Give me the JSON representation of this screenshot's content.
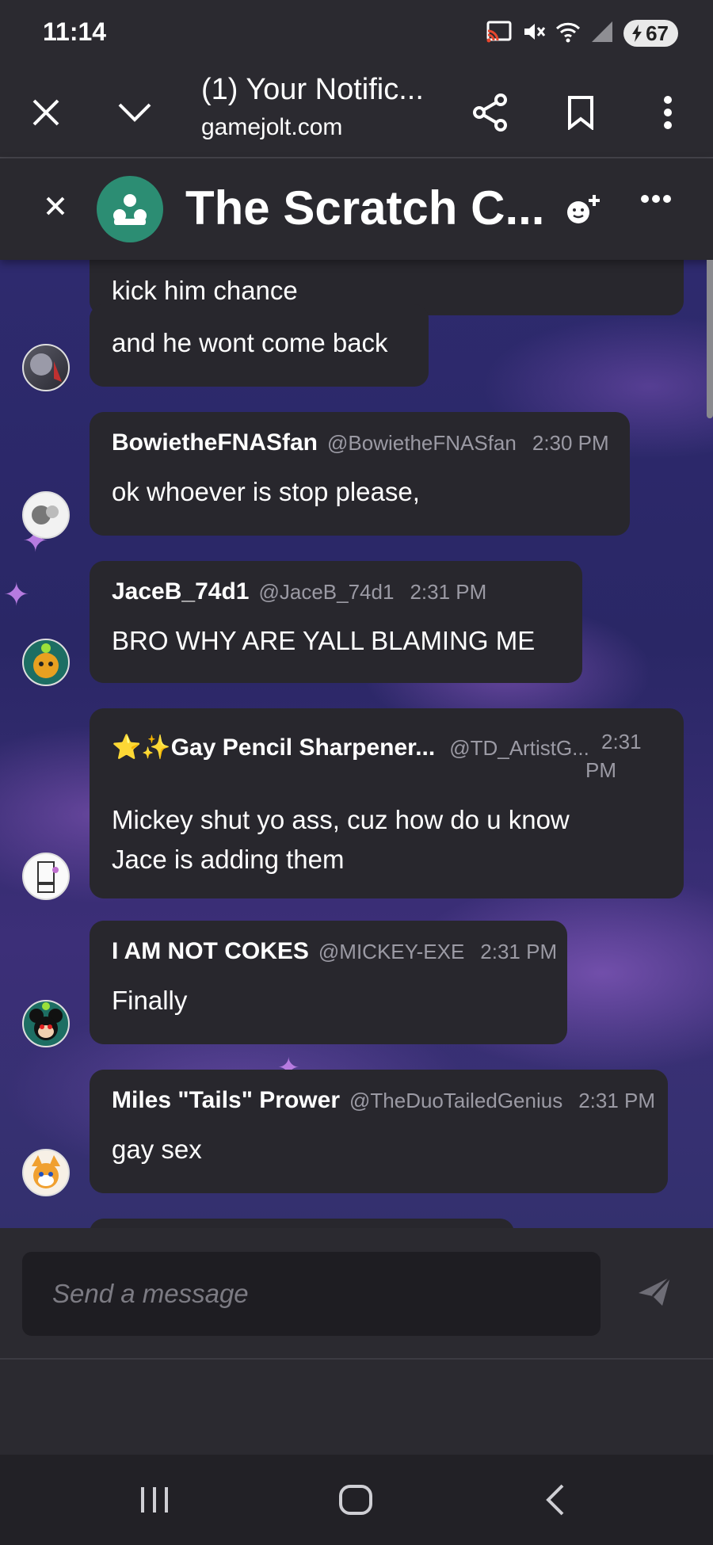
{
  "status_bar": {
    "time": "11:14",
    "battery": "67"
  },
  "browser": {
    "title": "(1) Your Notific...",
    "url": "gamejolt.com"
  },
  "chat": {
    "title": "The Scratch C..."
  },
  "messages": [
    {
      "text_partial": "kick him chance"
    },
    {
      "text": "and he wont come back"
    },
    {
      "username": "BowietheFNASfan",
      "handle": "@BowietheFNASfan",
      "time": "2:30 PM",
      "text": "ok whoever is stop please,"
    },
    {
      "username": "JaceB_74d1",
      "handle": "@JaceB_74d1",
      "time": "2:31 PM",
      "text": "BRO WHY ARE YALL BLAMING ME"
    },
    {
      "username": "⭐✨Gay Pencil Sharpener...",
      "handle": "@TD_ArtistG...",
      "time_1": "2:31",
      "time_2": "PM",
      "text_1": "Mickey shut yo ass, cuz how do u know",
      "text_2": "Jace is adding them"
    },
    {
      "username": "I AM NOT COKES",
      "handle": "@MICKEY-EXE",
      "time": "2:31 PM",
      "text": "Finally"
    },
    {
      "username": "Miles \"Tails\" Prower",
      "handle": "@TheDuoTailedGenius",
      "time": "2:31 PM",
      "text": "gay sex"
    }
  ],
  "composer": {
    "placeholder": "Send a message"
  },
  "icons": {
    "cast": "cast-icon",
    "mute": "mute-icon",
    "wifi": "wifi-icon",
    "signal": "signal-icon",
    "close": "close-icon",
    "chevron": "chevron-down-icon",
    "share": "share-icon",
    "bookmark": "bookmark-icon",
    "more": "more-vert-icon",
    "group": "group-icon",
    "add_user": "add-user-icon",
    "more_h": "more-horiz-icon",
    "send": "send-icon"
  },
  "colors": {
    "bubble": "#28272d",
    "header": "#2a292f",
    "group_avatar": "#2c8d73",
    "background": "#2e2a6e"
  }
}
